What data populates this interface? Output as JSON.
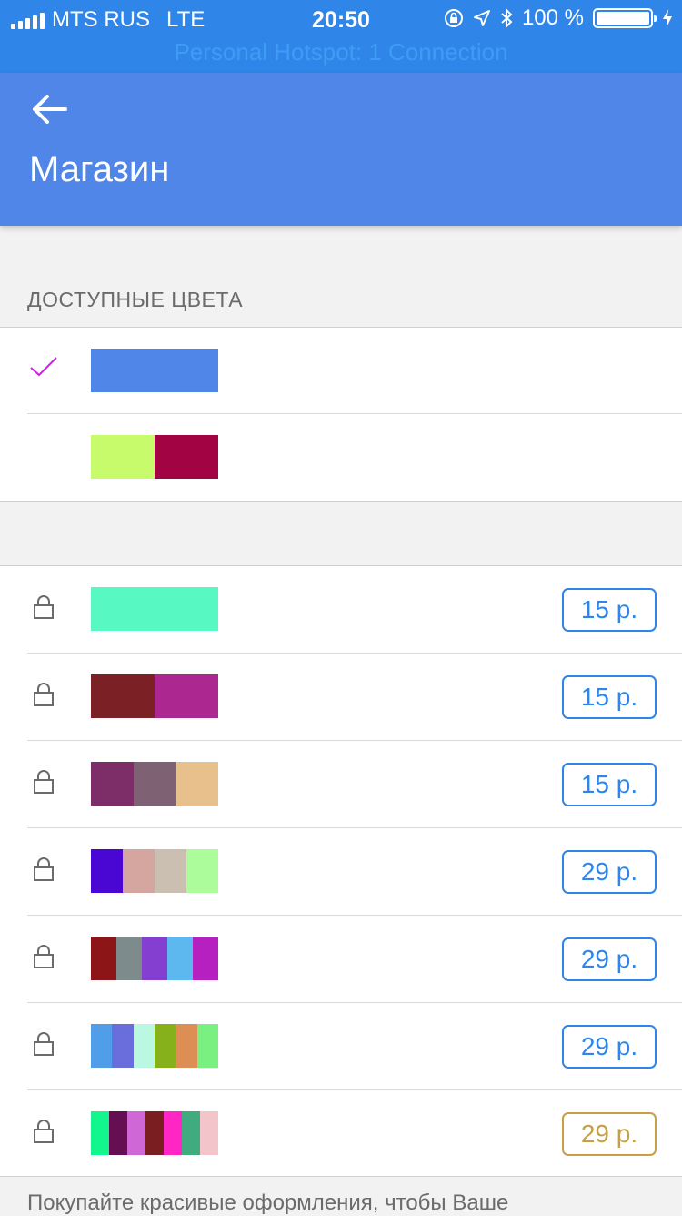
{
  "status_bar": {
    "carrier": "MTS RUS",
    "network": "LTE",
    "time": "20:50",
    "battery": "100 %",
    "battery_level": 1.0,
    "hotspot": "Personal Hotspot: 1 Connection"
  },
  "header": {
    "title": "Магазин"
  },
  "available": {
    "section_title": "ДОСТУПНЫЕ ЦВЕТА",
    "items": [
      {
        "selected": true,
        "colors": [
          "#5086e8"
        ]
      },
      {
        "selected": false,
        "colors": [
          "#c8fb6b",
          "#a10343"
        ]
      }
    ]
  },
  "shop": {
    "items": [
      {
        "price": "15 р.",
        "colors": [
          "#58f8c2"
        ]
      },
      {
        "price": "15 р.",
        "colors": [
          "#7b2024",
          "#ac2790"
        ]
      },
      {
        "price": "15 р.",
        "colors": [
          "#7d2e69",
          "#7e6172",
          "#e7c08b"
        ]
      },
      {
        "price": "29 р.",
        "colors": [
          "#4a06d3",
          "#d5a59f",
          "#cbbfb1",
          "#adfc9b"
        ]
      },
      {
        "price": "29 р.",
        "colors": [
          "#8c1517",
          "#7e8b8c",
          "#843ed0",
          "#5db8f0",
          "#b620c0"
        ]
      },
      {
        "price": "29 р.",
        "colors": [
          "#509ee9",
          "#6a6ddc",
          "#baf8e1",
          "#86b11a",
          "#dc8e54",
          "#7af080"
        ]
      },
      {
        "price": "29 р.",
        "colors": [
          "#13f58d",
          "#650f52",
          "#d067d7",
          "#7a1e21",
          "#ff26c5",
          "#3fab7f",
          "#f3c5cb"
        ],
        "highlight": "#c5a046"
      }
    ]
  },
  "footer": {
    "text": "Покупайте красивые оформления, чтобы Ваше"
  }
}
